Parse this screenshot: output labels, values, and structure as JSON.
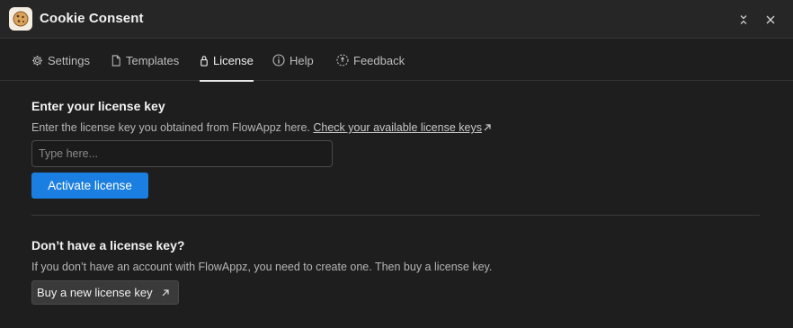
{
  "window": {
    "title": "Cookie Consent",
    "icon": "cookie-icon"
  },
  "tabs": [
    {
      "label": "Settings",
      "icon": "gear-icon"
    },
    {
      "label": "Templates",
      "icon": "document-icon"
    },
    {
      "label": "License",
      "icon": "lock-icon",
      "active": true
    },
    {
      "label": "Help",
      "icon": "info-icon"
    },
    {
      "label": "Feedback",
      "icon": "feedback-icon"
    }
  ],
  "license": {
    "heading": "Enter your license key",
    "description": "Enter the license key you obtained from FlowAppz here.",
    "link_text": "Check your available license keys",
    "input_placeholder": "Type here...",
    "input_value": "",
    "activate_label": "Activate license"
  },
  "no_key": {
    "heading": "Don’t have a license key?",
    "description": "If you don’t have an account with FlowAppz, you need to create one. Then buy a license key.",
    "buy_label": "Buy a new license key"
  },
  "colors": {
    "background": "#1e1e1e",
    "titlebar": "#262626",
    "accent": "#1a7fe0",
    "secondary_button": "#3a3a3a"
  }
}
